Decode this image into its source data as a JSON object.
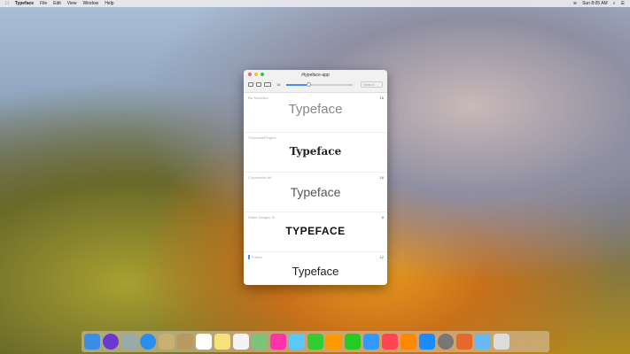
{
  "menubar": {
    "app": "Typeface",
    "items": [
      "File",
      "Edit",
      "View",
      "Window",
      "Help"
    ],
    "clock": "Sun 8:05 AM"
  },
  "window": {
    "title": "#typeface-app",
    "search_placeholder": "Search",
    "size_label": "16",
    "fonts": [
      {
        "name": "Bw Modelica",
        "count": "16",
        "sample": "Typeface"
      },
      {
        "name": "ChocolateFingers",
        "count": "",
        "sample": "Typeface"
      },
      {
        "name": "Corporative Alt",
        "count": "16",
        "sample": "Typeface"
      },
      {
        "name": "Diane Kangen XI",
        "count": "8",
        "sample": "TYPEFACE"
      },
      {
        "name": "Futura",
        "count": "12",
        "sample": "Typeface"
      }
    ]
  },
  "colors": {
    "accent": "#3b8ff5",
    "close": "#fc5f57",
    "min": "#fdbc2e",
    "max": "#28c840"
  },
  "dock": [
    "finder",
    "siri",
    "launchpad",
    "safari",
    "photo-viewer",
    "contacts",
    "calendar",
    "notes",
    "reminders",
    "maps",
    "photos",
    "messages",
    "facetime",
    "pages",
    "numbers",
    "keynote",
    "music",
    "books",
    "app-store",
    "system-preferences",
    "typeface",
    "downloads",
    "trash"
  ]
}
